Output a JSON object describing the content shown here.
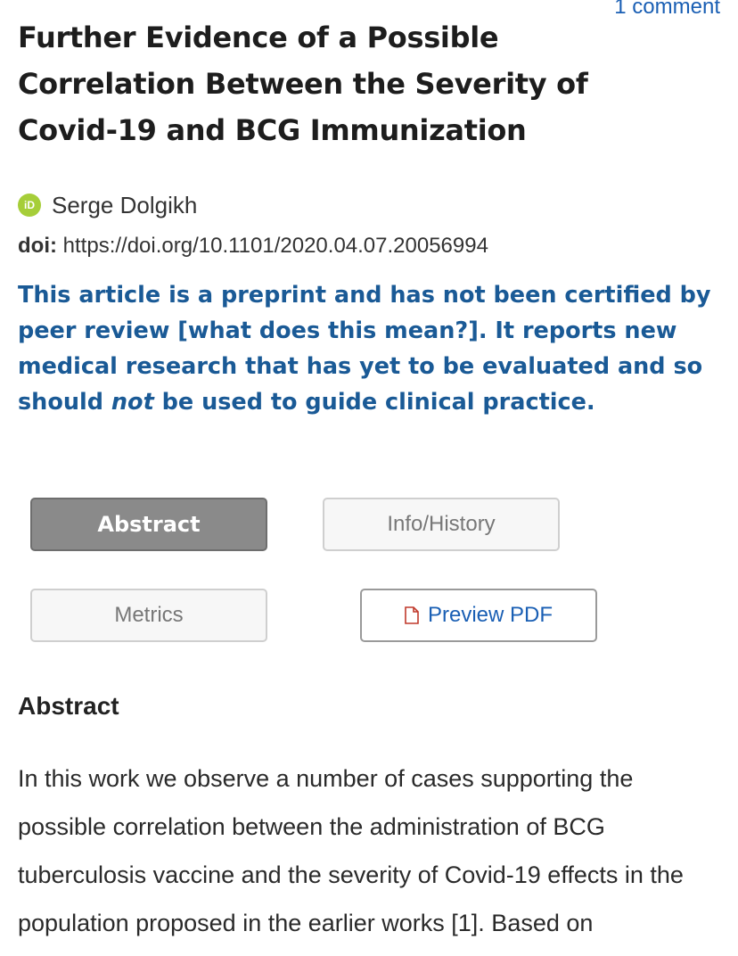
{
  "header": {
    "comment_link": "1 comment"
  },
  "article": {
    "title": "Further Evidence of a Possible Correlation Between the Severity of Covid-19 and BCG Immunization",
    "author": "Serge Dolgikh",
    "author_icon": "orcid-icon",
    "author_icon_text": "iD",
    "doi_label": "doi:",
    "doi_url": "https://doi.org/10.1101/2020.04.07.20056994"
  },
  "notice": {
    "part1": "This article is a preprint and has not been certified by peer review ",
    "link": "[what does this mean?]",
    "part2": ". It reports new medical research that has yet to be evaluated and so should ",
    "emphasis": "not",
    "part3": " be used to guide clinical practice."
  },
  "tabs": {
    "abstract": "Abstract",
    "info_history": "Info/History",
    "metrics": "Metrics",
    "preview_pdf": "Preview PDF",
    "active": "Abstract"
  },
  "abstract": {
    "heading": "Abstract",
    "text": "In this work we observe a number of cases supporting the possible correlation between the administration of BCG tuberculosis vaccine and the severity of Covid-19 effects in the population proposed in the earlier works [1]. Based on"
  },
  "colors": {
    "notice_blue": "#1a5a96",
    "link_blue": "#1a5fb4",
    "orcid_green": "#a6ce39",
    "active_tab": "#8a8a8a",
    "pdf_red": "#c0392b"
  }
}
